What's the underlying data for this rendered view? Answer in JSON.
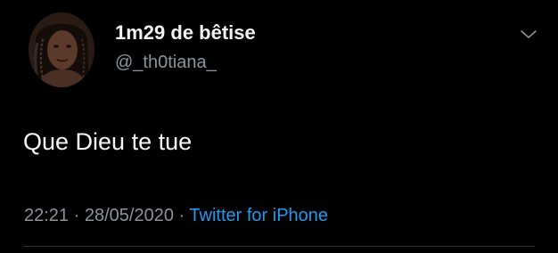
{
  "tweet": {
    "author": {
      "display_name": "1m29 de bêtise",
      "handle": "@_th0tiana_",
      "avatar_icon": "profile-photo"
    },
    "text": "Que Dieu te tue",
    "time": "22:21",
    "separator": "·",
    "date": "28/05/2020",
    "source": "Twitter for iPhone",
    "menu_icon": "chevron-down-icon"
  },
  "colors": {
    "background": "#000000",
    "text": "#f5f5f5",
    "muted": "#8a949b",
    "link": "#1d9bf0"
  }
}
